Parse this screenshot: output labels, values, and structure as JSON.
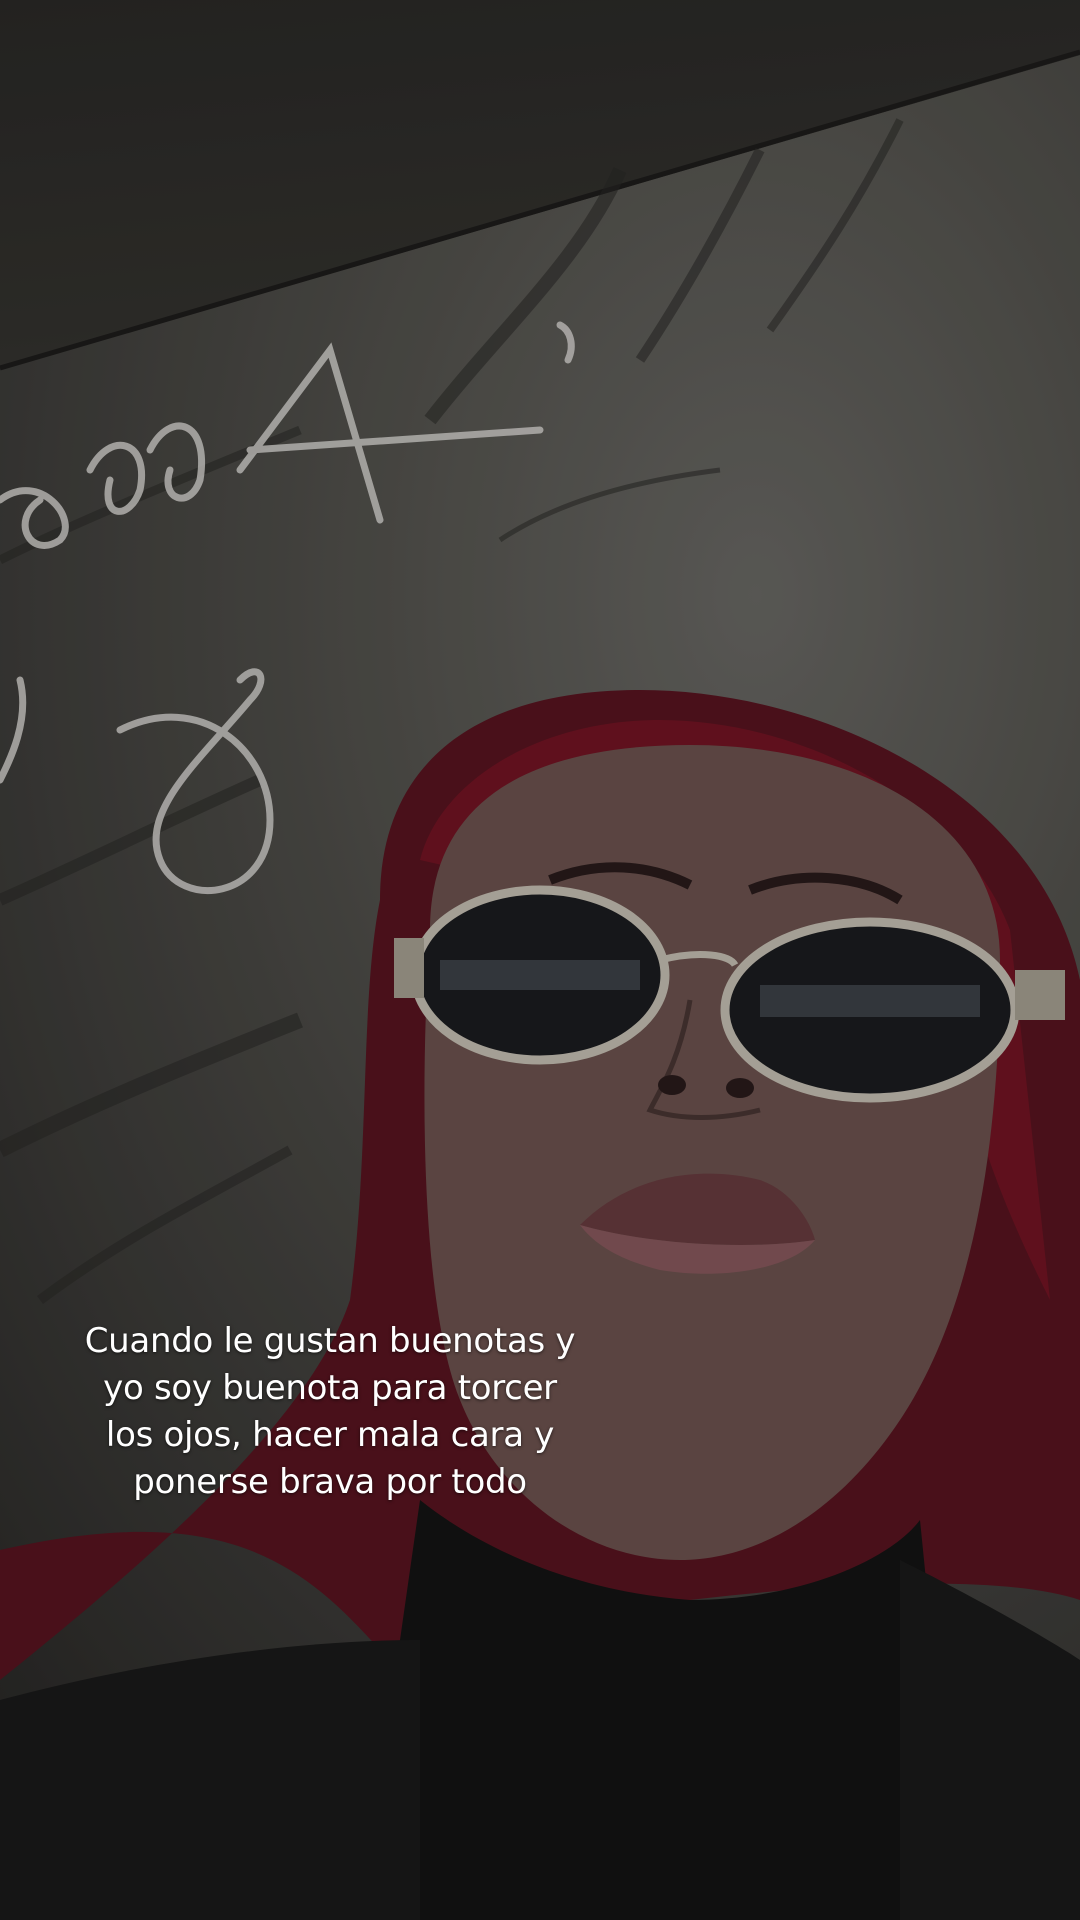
{
  "caption": {
    "text": "Cuando le gustan buenotas y yo soy buenota para torcer los ojos, hacer mala cara y ponerse brava por todo"
  },
  "colors": {
    "hair": "#7a1426",
    "skin": "#6e5450",
    "shirt": "#141414",
    "wall": "#55544f",
    "neon": "#d8d6d2",
    "caption_text": "#ffffff"
  },
  "scene": {
    "subject": "person-with-sunglasses",
    "background": "marble-wall-with-neon-sign"
  }
}
